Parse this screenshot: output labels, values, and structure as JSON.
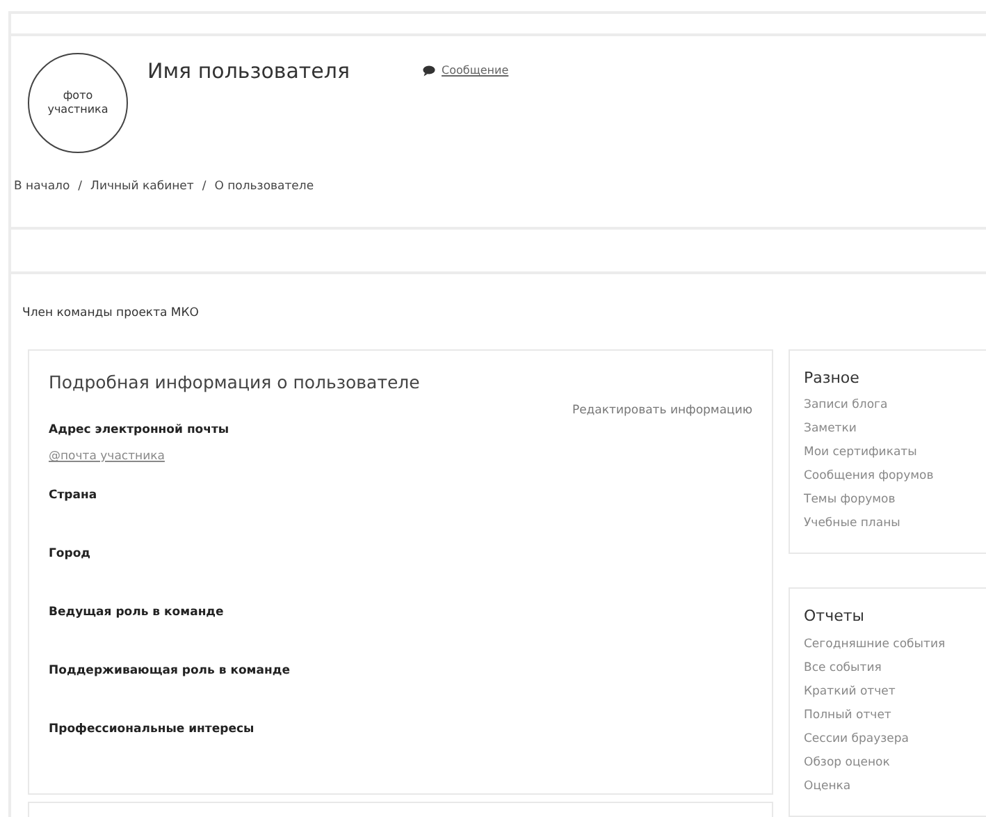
{
  "user": {
    "photo_label": "фото участника",
    "name": "Имя пользователя",
    "message_link": "Сообщение"
  },
  "breadcrumb": [
    "В начало",
    "Личный кабинет",
    "О пользователе"
  ],
  "breadcrumb_separator": "/",
  "role_description": "Член команды проекта МКО",
  "details": {
    "title": "Подробная информация о пользователе",
    "edit_link": "Редактировать информацию",
    "fields": [
      {
        "label": "Адрес электронной почты",
        "value": "@почта участника"
      },
      {
        "label": "Страна"
      },
      {
        "label": "Город"
      },
      {
        "label": "Ведущая роль в команде"
      },
      {
        "label": "Поддерживающая роль в команде"
      },
      {
        "label": "Профессиональные интересы"
      }
    ]
  },
  "side_blocks": [
    {
      "title": "Разное",
      "links": [
        "Записи блога",
        "Заметки",
        "Мои сертификаты",
        "Сообщения форумов",
        "Темы форумов",
        "Учебные планы"
      ]
    },
    {
      "title": "Отчеты",
      "links": [
        "Сегодняшние события",
        "Все события",
        "Краткий отчет",
        "Полный отчет",
        "Сессии браузера",
        "Обзор оценок",
        "Оценка"
      ]
    }
  ]
}
